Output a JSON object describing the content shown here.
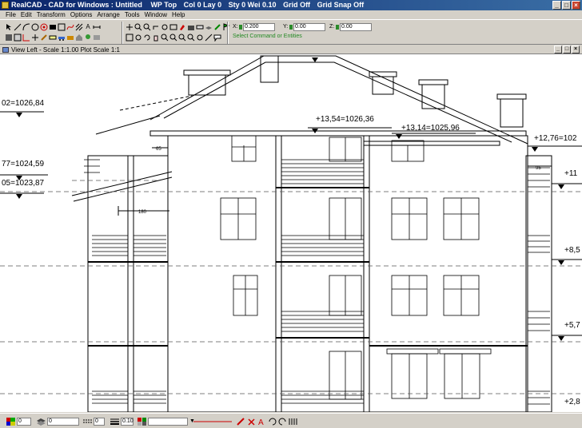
{
  "window": {
    "title": "RealCAD - CAD for Windows : Untitled",
    "status_items": [
      "WP Top",
      "Col 0 Lay 0",
      "Sty 0 Wei 0.10",
      "Grid Off",
      "Grid Snap Off"
    ],
    "buttons": {
      "minimize": "_",
      "maximize": "□",
      "close": "×"
    }
  },
  "menu": [
    "File",
    "Edit",
    "Transform",
    "Options",
    "Arrange",
    "Tools",
    "Window",
    "Help"
  ],
  "coords": {
    "x_label": "X:",
    "x_value": "0.200",
    "y_label": "Y:",
    "y_value": "0.00",
    "z_label": "Z:",
    "z_value": "0.00"
  },
  "command_prompt": "Select Command or Entities",
  "view": {
    "title": "View Left - Scale 1:1.00 Plot Scale 1:1"
  },
  "drawing": {
    "elevations": [
      "02=1026,84",
      "+13,54=1026,36",
      "+13,14=1025,96",
      "77=1024,59",
      "05=1023,87",
      "+12,76=102",
      "+11",
      "+8,5",
      "+5,7",
      "+2,8"
    ],
    "dimensions": [
      "65",
      "180",
      "95"
    ]
  },
  "statusbar": {
    "color_value": "0",
    "layer_value": "0",
    "style_value": "0",
    "weight_value": "0.10"
  },
  "colors": {
    "titlebar": "#0a246a",
    "accent": "#c8432e",
    "lock": "#2a8a2a"
  }
}
